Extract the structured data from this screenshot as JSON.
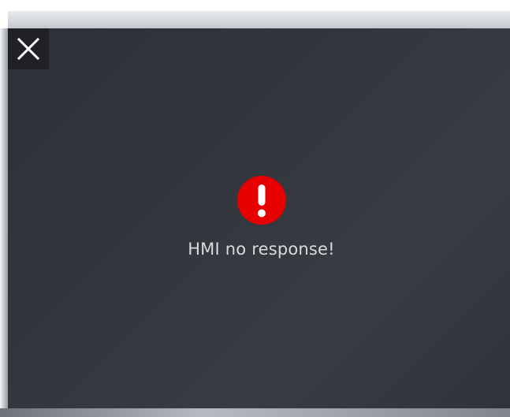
{
  "dialog": {
    "close_icon": "close-icon",
    "alert_icon": "exclamation-circle-icon",
    "alert_color": "#e60000",
    "message": "HMI no response!"
  },
  "colors": {
    "dialog_background": "#33373d",
    "text": "#d8dadd",
    "close_button_background": "#1f2125"
  }
}
